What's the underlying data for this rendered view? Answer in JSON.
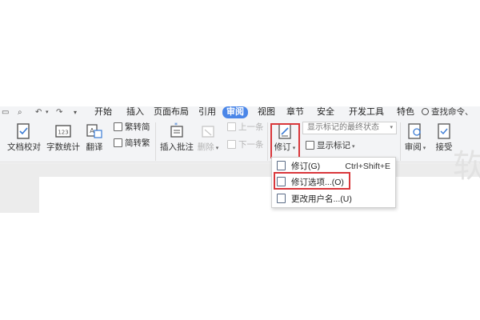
{
  "tabbar": {
    "tabs": [
      "开始",
      "插入",
      "页面布局",
      "引用",
      "审阅",
      "视图",
      "章节",
      "安全",
      "开发工具",
      "特色"
    ],
    "active_tab": "审阅",
    "search_label": "查找命令、"
  },
  "ribbon": {
    "doc_proof": "文档校对",
    "word_count": "字数统计",
    "translate": "翻译",
    "trad_to_simp": "繁转简",
    "simp_to_trad": "简转繁",
    "insert_comment": "插入批注",
    "delete": "删除",
    "prev": "上一条",
    "next": "下一条",
    "revision": "修订",
    "display_state": "显示标记的最终状态",
    "show_markup": "显示标记",
    "review": "审阅",
    "accept": "接受",
    "watermark_char": "软"
  },
  "menu": {
    "items": [
      {
        "label": "修订(G)",
        "shortcut": "Ctrl+Shift+E"
      },
      {
        "label": "修订选项...(O)",
        "shortcut": ""
      },
      {
        "label": "更改用户名...(U)",
        "shortcut": ""
      }
    ]
  },
  "colors": {
    "accent_tab": "#4a86e8",
    "highlight_red": "#d9373b"
  }
}
